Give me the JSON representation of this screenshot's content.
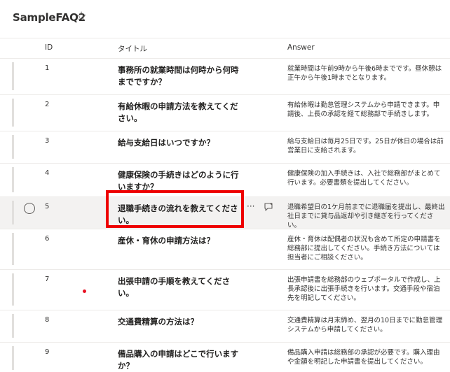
{
  "list": {
    "title": "SampleFAQ2",
    "favorite_icon": "star-icon"
  },
  "columns": {
    "id": "ID",
    "title": "タイトル",
    "answer": "Answer"
  },
  "rows": [
    {
      "id": "1",
      "title": "事務所の就業時間は何時から何時までですか？",
      "answer": "就業時間は午前9時から午後6時までです。昼休憩は正午から午後1時までとなります。"
    },
    {
      "id": "2",
      "title": "有給休暇の申請方法を教えてください。",
      "answer": "有給休暇は勤怠管理システムから申請できます。申請後、上長の承認を経て総務部で手続きします。"
    },
    {
      "id": "3",
      "title": "給与支給日はいつですか？",
      "answer": "給与支給日は毎月25日です。25日が休日の場合は前営業日に支給されます。"
    },
    {
      "id": "4",
      "title": "健康保険の手続きはどのように行いますか？",
      "answer": "健康保険の加入手続きは、入社で総務部がまとめて行います。必要書類を提出してください。"
    },
    {
      "id": "5",
      "title": "退職手続きの流れを教えてください。",
      "answer": "退職希望日の1ケ月前までに退職届を提出し、最終出社日までに貸与品返却や引き継ぎを行ってください。",
      "selected": true
    },
    {
      "id": "6",
      "title": "産休・育休の申請方法は？",
      "answer": "産休・育休は配偶者の状況も含めて所定の申請書を総務部に提出してください。手続き方法については担当者にご相談ください。"
    },
    {
      "id": "7",
      "title": "出張申請の手順を教えてください。",
      "answer": "出張申請書を総務部のウェブポータルで作成し、上長承認後に出張手続きを行います。交通手段や宿泊先を明記してください。"
    },
    {
      "id": "8",
      "title": "交通費精算の方法は？",
      "answer": "交通費精算は月末締め、翌月の10日までに勤怠管理システムから申請してください。"
    },
    {
      "id": "9",
      "title": "備品購入の申請はどこで行いますか？",
      "answer": "備品購入申請は総務部の承認が必要です。購入理由や金額を明記した申請書を提出してください。"
    }
  ]
}
